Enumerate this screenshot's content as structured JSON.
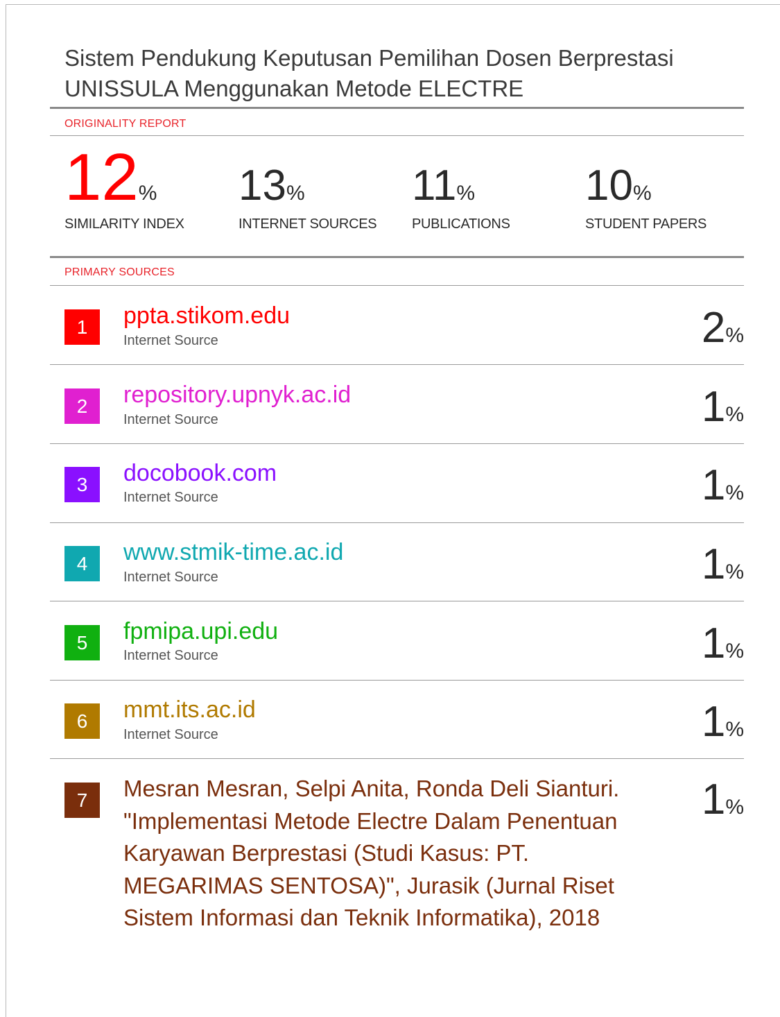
{
  "title": "Sistem Pendukung Keputusan Pemilihan Dosen Berprestasi UNISSULA Menggunakan Metode ELECTRE",
  "originality_label": "ORIGINALITY REPORT",
  "primary_sources_label": "PRIMARY SOURCES",
  "stats": [
    {
      "value": "12",
      "pct": "%",
      "label": "SIMILARITY INDEX"
    },
    {
      "value": "13",
      "pct": "%",
      "label": "INTERNET SOURCES"
    },
    {
      "value": "11",
      "pct": "%",
      "label": "PUBLICATIONS"
    },
    {
      "value": "10",
      "pct": "%",
      "label": "STUDENT PAPERS"
    }
  ],
  "sources": [
    {
      "num": "1",
      "name": "ppta.stikom.edu",
      "type": "Internet Source",
      "value": "2",
      "pct": "%",
      "color": "#ff0000"
    },
    {
      "num": "2",
      "name": "repository.upnyk.ac.id",
      "type": "Internet Source",
      "value": "1",
      "pct": "%",
      "color": "#e020d0"
    },
    {
      "num": "3",
      "name": "docobook.com",
      "type": "Internet Source",
      "value": "1",
      "pct": "%",
      "color": "#8a10ff"
    },
    {
      "num": "4",
      "name": "www.stmik-time.ac.id",
      "type": "Internet Source",
      "value": "1",
      "pct": "%",
      "color": "#10a8b0"
    },
    {
      "num": "5",
      "name": "fpmipa.upi.edu",
      "type": "Internet Source",
      "value": "1",
      "pct": "%",
      "color": "#10b010"
    },
    {
      "num": "6",
      "name": "mmt.its.ac.id",
      "type": "Internet Source",
      "value": "1",
      "pct": "%",
      "color": "#b07a00"
    },
    {
      "num": "7",
      "citation": "Mesran Mesran, Selpi Anita, Ronda Deli Sianturi. \"Implementasi Metode Electre Dalam Penentuan Karyawan Berprestasi (Studi Kasus: PT. MEGARIMAS SENTOSA)\", Jurasik (Jurnal Riset Sistem Informasi dan Teknik Informatika), 2018",
      "value": "1",
      "pct": "%",
      "color": "#7a2e0c"
    }
  ]
}
